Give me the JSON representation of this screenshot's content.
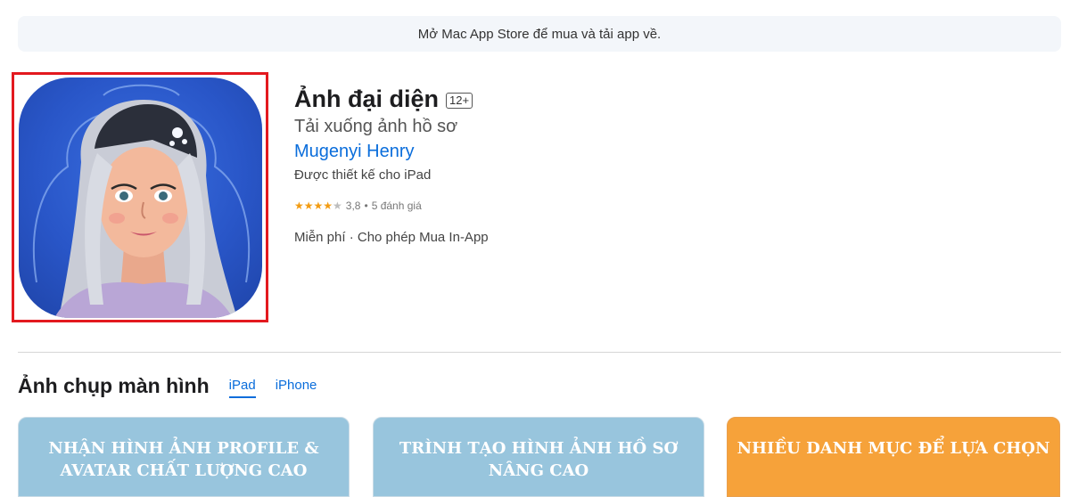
{
  "banner": {
    "text": "Mở Mac App Store để mua và tải app về."
  },
  "app": {
    "title": "Ảnh đại diện",
    "age_rating": "12+",
    "subtitle": "Tải xuống ảnh hồ sơ",
    "developer": "Mugenyi Henry",
    "designed_for": "Được thiết kế cho iPad",
    "rating": {
      "value": "3,8",
      "separator": "•",
      "count_label": "5 đánh giá",
      "stars_filled": 4,
      "stars_total": 5
    },
    "price": "Miễn phí · Cho phép Mua In-App",
    "icon_name": "app-icon-avatar-girl"
  },
  "screenshots_section": {
    "title": "Ảnh chụp màn hình",
    "tabs": [
      {
        "label": "iPad",
        "active": true
      },
      {
        "label": "iPhone",
        "active": false
      }
    ],
    "cards": [
      {
        "line1": "NHẬN HÌNH ẢNH PROFILE &",
        "line2": "AVATAR CHẤT LƯỢNG CAO"
      },
      {
        "line1": "TRÌNH TẠO HÌNH ẢNH HỒ SƠ",
        "line2": "NÂNG CAO"
      },
      {
        "line1": "NHIỀU DANH MỤC ĐỂ LỰA CHỌN",
        "line2": ""
      }
    ]
  },
  "colors": {
    "accent": "#0a6ddb",
    "highlight_frame": "#e3191f",
    "star": "#f39c12",
    "card_blue": "#98c5dd",
    "card_orange": "#f6a23a"
  }
}
